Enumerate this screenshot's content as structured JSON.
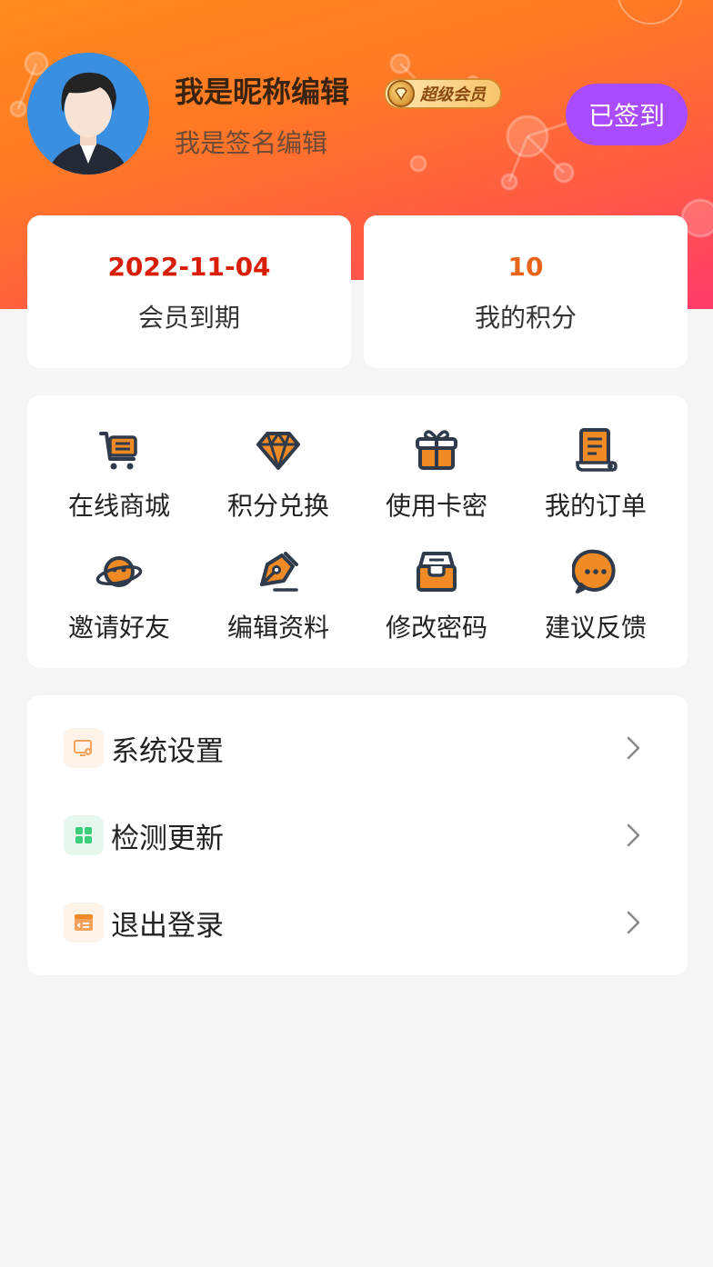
{
  "profile": {
    "nickname": "我是昵称编辑",
    "vip_label": "超级会员",
    "signature": "我是签名编辑",
    "checkin_label": "已签到"
  },
  "stats": {
    "expiry": {
      "value": "2022-11-04",
      "label": "会员到期",
      "color": "#d81e06"
    },
    "points": {
      "value": "10",
      "label": "我的积分",
      "color": "#e8641b"
    }
  },
  "grid": [
    {
      "label": "在线商城",
      "icon": "cart-icon"
    },
    {
      "label": "积分兑换",
      "icon": "diamond-icon"
    },
    {
      "label": "使用卡密",
      "icon": "gift-icon"
    },
    {
      "label": "我的订单",
      "icon": "order-icon"
    },
    {
      "label": "邀请好友",
      "icon": "planet-icon"
    },
    {
      "label": "编辑资料",
      "icon": "pen-icon"
    },
    {
      "label": "修改密码",
      "icon": "box-icon"
    },
    {
      "label": "建议反馈",
      "icon": "chat-icon"
    }
  ],
  "menu": [
    {
      "label": "系统设置",
      "icon": "monitor-settings-icon",
      "icon_bg": "#fff2e8",
      "icon_color": "#f5a25d"
    },
    {
      "label": "检测更新",
      "icon": "apps-grid-icon",
      "icon_bg": "#e6f8ee",
      "icon_color": "#3ccf7a"
    },
    {
      "label": "退出登录",
      "icon": "logout-card-icon",
      "icon_bg": "#fff2e8",
      "icon_color": "#f5a25d"
    }
  ],
  "colors": {
    "accent_orange": "#f08a24",
    "checkin_purple": "#a94bff",
    "icon_dark": "#2f3a4a"
  }
}
